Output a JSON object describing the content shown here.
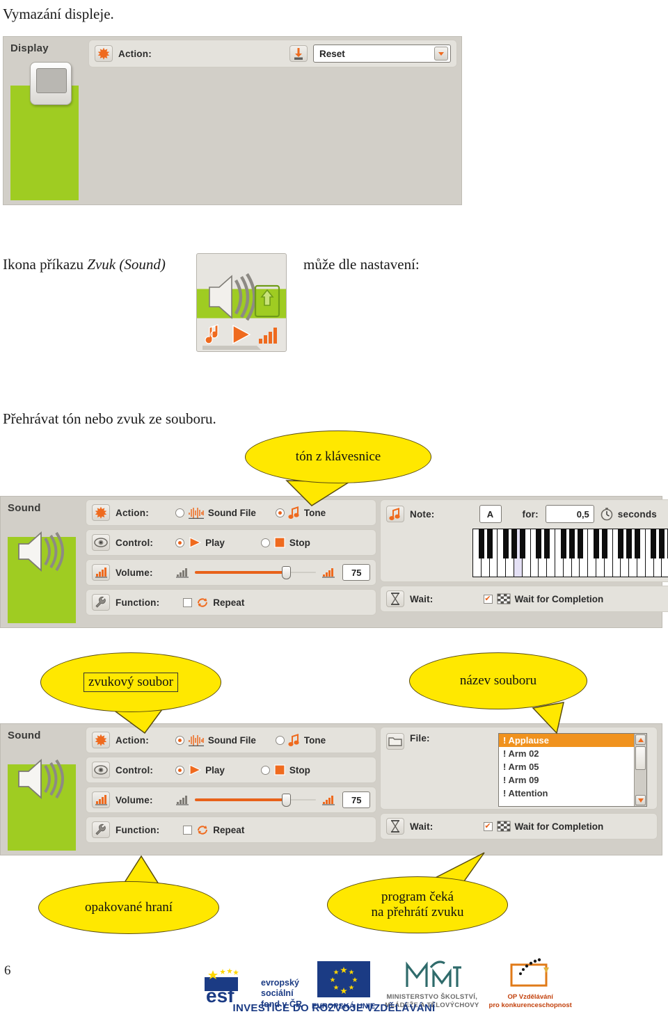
{
  "document": {
    "page_number": "6",
    "intro_text": "Vymazání displeje.",
    "sound_sentence_prefix": "Ikona příkazu ",
    "sound_sentence_italic": "Zvuk (Sound)",
    "sound_sentence_suffix": "může dle nastavení:",
    "play_sentence": "Přehrávat tón nebo zvuk ze souboru."
  },
  "display_panel": {
    "title": "Display",
    "action_row": {
      "label": "Action:",
      "action_icon": "orange-starburst-icon",
      "download_icon": "download-arrow-icon",
      "combo_value": "Reset",
      "combo_arrow_icon": "chevron-down-icon"
    },
    "screen_icon": "nxt-display-screen-icon",
    "green_color": "#9fcc22",
    "panel_color": "#d2cfc8"
  },
  "sound_command_icon": {
    "name": "sound-command-block-icon",
    "speaker_icon": "speaker-waves-icon",
    "file_arrow_icon": "file-up-arrow-icon",
    "note_icon": "music-note-icon",
    "play_icon": "play-triangle-icon",
    "volume_icon": "volume-bars-icon"
  },
  "sound_panel_tone": {
    "title": "Sound",
    "rows": {
      "action": {
        "label": "Action:",
        "icon": "orange-starburst-icon",
        "options": [
          {
            "label": "Sound File",
            "icon": "waveform-icon",
            "selected": false
          },
          {
            "label": "Tone",
            "icon": "music-note-icon",
            "selected": true
          }
        ]
      },
      "control": {
        "label": "Control:",
        "icon": "eye-icon",
        "options": [
          {
            "label": "Play",
            "icon": "play-triangle-icon",
            "selected": true
          },
          {
            "label": "Stop",
            "icon": "stop-square-icon",
            "selected": false
          }
        ]
      },
      "volume": {
        "label": "Volume:",
        "icon": "volume-bars-icon",
        "min_icon": "volume-low-icon",
        "max_icon": "volume-high-icon",
        "value": "75",
        "percent": 75
      },
      "function": {
        "label": "Function:",
        "icon": "wrench-icon",
        "checkbox_label": "Repeat",
        "checkbox_icon": "repeat-arrows-icon",
        "checked": false
      },
      "note": {
        "label": "Note:",
        "icon": "music-note-icon",
        "note_value": "A",
        "for_label": "for:",
        "duration_value": "0,5",
        "clock_icon": "stopwatch-icon",
        "seconds_label": "seconds",
        "selected_key_index": 5
      },
      "wait": {
        "label": "Wait:",
        "icon": "hourglass-icon",
        "checkbox_label": "Wait for Completion",
        "checkbox_icon": "checkered-flag-icon",
        "checked": true
      }
    }
  },
  "sound_panel_file": {
    "title": "Sound",
    "rows": {
      "action": {
        "label": "Action:",
        "icon": "orange-starburst-icon",
        "options": [
          {
            "label": "Sound File",
            "icon": "waveform-icon",
            "selected": true
          },
          {
            "label": "Tone",
            "icon": "music-note-icon",
            "selected": false
          }
        ]
      },
      "control": {
        "label": "Control:",
        "icon": "eye-icon",
        "options": [
          {
            "label": "Play",
            "icon": "play-triangle-icon",
            "selected": true
          },
          {
            "label": "Stop",
            "icon": "stop-square-icon",
            "selected": false
          }
        ]
      },
      "volume": {
        "label": "Volume:",
        "icon": "volume-bars-icon",
        "min_icon": "volume-low-icon",
        "max_icon": "volume-high-icon",
        "value": "75",
        "percent": 75
      },
      "function": {
        "label": "Function:",
        "icon": "wrench-icon",
        "checkbox_label": "Repeat",
        "checkbox_icon": "repeat-arrows-icon",
        "checked": false
      },
      "file": {
        "label": "File:",
        "icon": "folder-icon",
        "items": [
          {
            "label": "! Applause",
            "selected": true
          },
          {
            "label": "! Arm 02",
            "selected": false
          },
          {
            "label": "! Arm 05",
            "selected": false
          },
          {
            "label": "! Arm 09",
            "selected": false
          },
          {
            "label": "! Attention",
            "selected": false
          }
        ],
        "scroll_up_icon": "scroll-up-arrow-icon",
        "scroll_down_icon": "scroll-down-arrow-icon"
      },
      "wait": {
        "label": "Wait:",
        "icon": "hourglass-icon",
        "checkbox_label": "Wait for Completion",
        "checkbox_icon": "checkered-flag-icon",
        "checked": true
      }
    }
  },
  "callouts": [
    {
      "id": "tone-keyboard",
      "text": "tón z klávesnice",
      "boxed": false
    },
    {
      "id": "sound-file",
      "text": "zvukový soubor",
      "boxed": true
    },
    {
      "id": "file-name",
      "text": "název souboru",
      "boxed": false
    },
    {
      "id": "repeat-play",
      "text": "opakované hraní",
      "boxed": false
    },
    {
      "id": "wait-for-sound",
      "text": "program čeká\nna přehrátí zvuku",
      "boxed": false
    }
  ],
  "footer": {
    "esf": {
      "line1": "evropský",
      "line2": "sociální",
      "line3": "fond v ČR"
    },
    "eu_label": "EVROPSKÁ UNIE",
    "msmt": {
      "line1": "MINISTERSTVO ŠKOLSTVÍ,",
      "line2": "MLÁDEŽE A TĚLOVÝCHOVY"
    },
    "op": {
      "line1": "OP Vzdělávání",
      "line2": "pro konkurenceschopnost"
    },
    "tagline": "INVESTICE DO ROZVOJE VZDĚLÁVÁNÍ",
    "brand_color": "#1b3b84",
    "op_color": "#e07a18"
  }
}
